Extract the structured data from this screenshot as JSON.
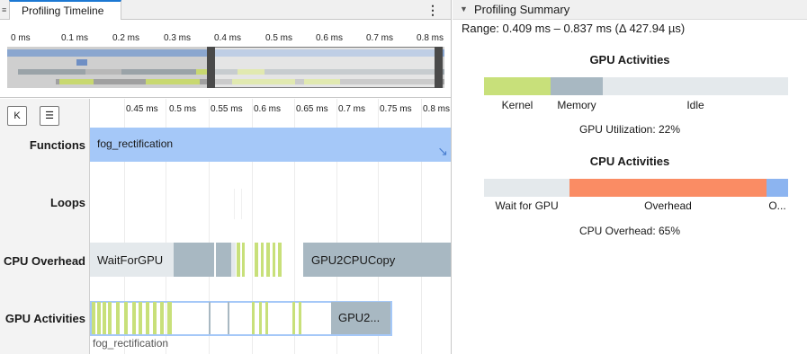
{
  "tab": {
    "title": "Profiling Timeline",
    "menu": "⋮"
  },
  "overview": {
    "ticks": [
      "0 ms",
      "0.1 ms",
      "0.2 ms",
      "0.3 ms",
      "0.4 ms",
      "0.5 ms",
      "0.6 ms",
      "0.7 ms",
      "0.8 ms"
    ]
  },
  "timeline": {
    "buttons": {
      "keyboard": "K",
      "legend": "☰"
    },
    "axis_ticks": [
      "0.45 ms",
      "0.5 ms",
      "0.55 ms",
      "0.6 ms",
      "0.65 ms",
      "0.7 ms",
      "0.75 ms",
      "0.8 ms"
    ],
    "rows": {
      "functions": "Functions",
      "loops": "Loops",
      "cpu_overhead": "CPU Overhead",
      "gpu_activities": "GPU Activities"
    },
    "function_bar": {
      "label": "fog_rectification",
      "link_icon": "↘"
    },
    "cpu": {
      "wait_label": "WaitForGPU",
      "copy_label": "GPU2CPUCopy"
    },
    "gpu": {
      "copy_label": "GPU2...",
      "kernel_caption": "fog_rectification"
    }
  },
  "summary": {
    "title": "Profiling Summary",
    "range": "Range: 0.409 ms – 0.837 ms (Δ 427.94 µs)",
    "gpu_section": {
      "title": "GPU Activities",
      "labels": [
        "Kernel",
        "Memory",
        "Idle"
      ],
      "utilization": "GPU Utilization: 22%"
    },
    "cpu_section": {
      "title": "CPU Activities",
      "labels": [
        "Wait for GPU",
        "Overhead",
        "O..."
      ],
      "overhead": "CPU Overhead: 65%"
    }
  },
  "colors": {
    "kernel": "#c8e07a",
    "memory": "#a8b8c2",
    "idle": "#e4e9ec",
    "function": "#a5c8f8",
    "overhead": "#fa8c64",
    "other": "#8cb4f0",
    "accent": "#1c78d3"
  }
}
